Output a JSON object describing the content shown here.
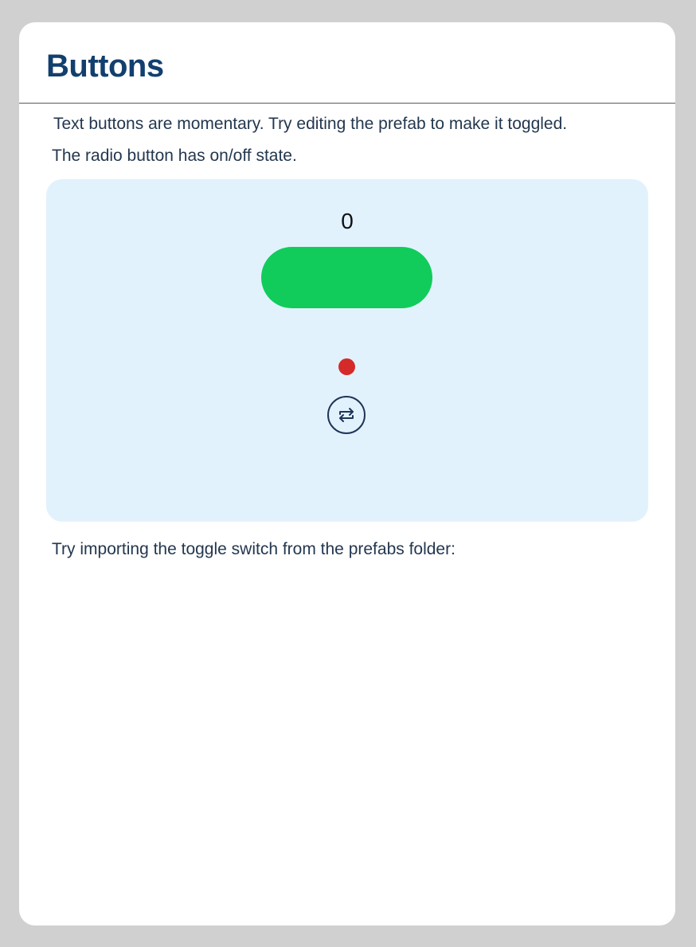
{
  "card": {
    "title": "Buttons",
    "intro_text": "Text buttons are momentary. Try editing the prefab to make it toggled.",
    "radio_text": "The radio button has on/off state.",
    "footer_text": "Try importing the toggle switch from the prefabs folder:"
  },
  "panel": {
    "counter_value": "0",
    "text_button_label": "",
    "radio_state": "off",
    "toggle_icon": "repeat-arrows-icon"
  },
  "colors": {
    "page_background": "#d0d0d0",
    "card_background": "#ffffff",
    "title": "#123f6e",
    "body_text": "#23374f",
    "panel_background": "#e2f2fd",
    "text_button": "#11cc5a",
    "radio_dot": "#d52a2a",
    "icon_stroke": "#1f3557"
  }
}
